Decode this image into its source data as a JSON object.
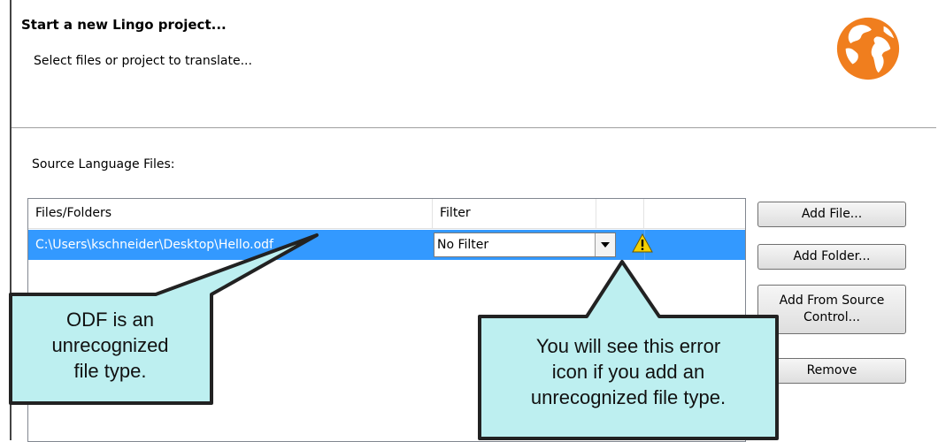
{
  "header": {
    "title": "Start a new Lingo project...",
    "subtitle": "Select files or project to translate..."
  },
  "section": {
    "label": "Source Language Files:"
  },
  "table": {
    "columns": [
      "Files/Folders",
      "Filter"
    ],
    "rows": [
      {
        "path": "C:\\Users\\kschneider\\Desktop\\Hello.odf",
        "filter": "No Filter"
      }
    ]
  },
  "buttons": {
    "add_file": "Add File...",
    "add_folder": "Add Folder...",
    "add_source_line1": "Add From Source",
    "add_source_line2": "Control...",
    "remove": "Remove"
  },
  "callouts": {
    "left_line1": "ODF is an",
    "left_line2": "unrecognized",
    "left_line3": "file type.",
    "right_line1": "You will see this error",
    "right_line2": "icon if you add an",
    "right_line3": "unrecognized file type."
  },
  "colors": {
    "selection": "#3399ff",
    "callout_fill": "#bdeff0",
    "globe": "#f07e1e",
    "warning": "#f5d000"
  },
  "icons": {
    "logo": "globe-icon",
    "warning": "warning-icon",
    "dropdown": "chevron-down-icon"
  }
}
